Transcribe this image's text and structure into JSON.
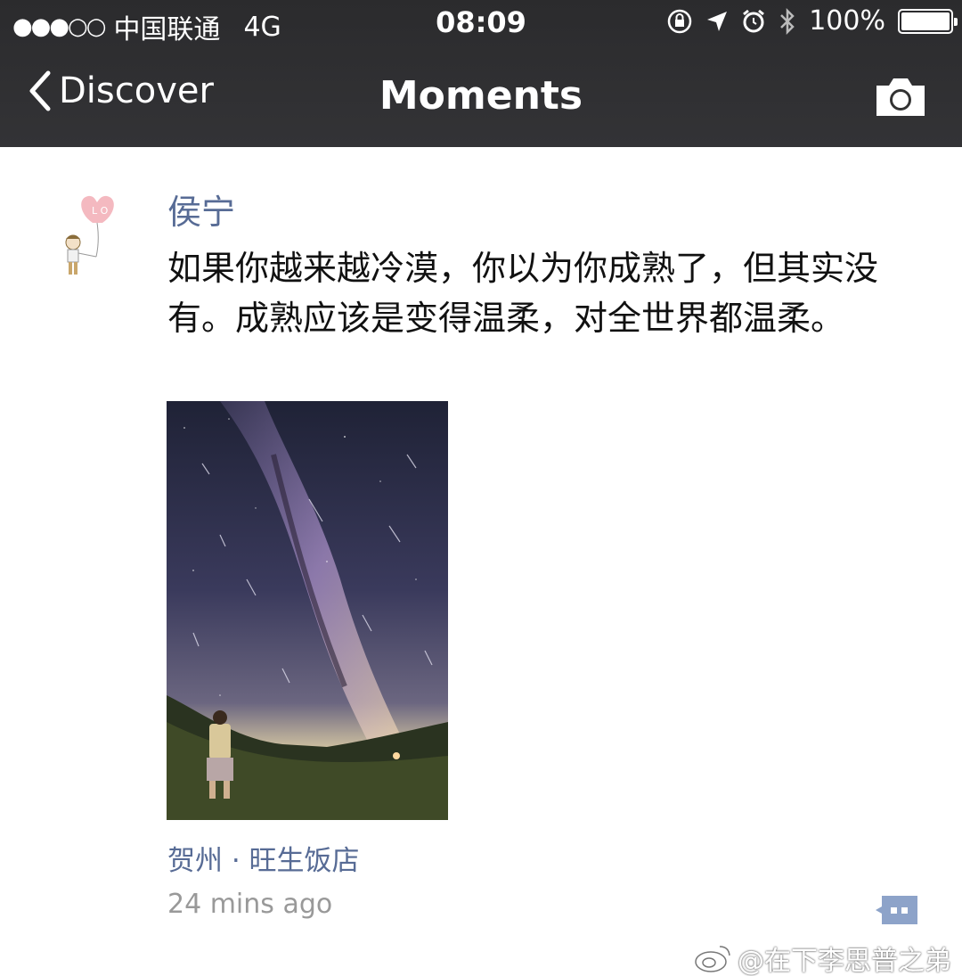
{
  "status_bar": {
    "signal": "●●●○○",
    "carrier": "中国联通",
    "network": "4G",
    "time": "08:09",
    "battery": "100%"
  },
  "nav": {
    "back_label": "Discover",
    "title": "Moments"
  },
  "post": {
    "username": "侯宁",
    "text": "如果你越来越冷漠，你以为你成熟了，但其实没有。成熟应该是变得温柔，对全世界都温柔。",
    "location": "贺州 · 旺生饭店",
    "time_ago": "24 mins ago"
  },
  "watermark": {
    "text": "@在下李思普之弟"
  },
  "colors": {
    "nav_bg": "#2e2e30",
    "link_blue": "#576b95",
    "muted": "#999999"
  }
}
